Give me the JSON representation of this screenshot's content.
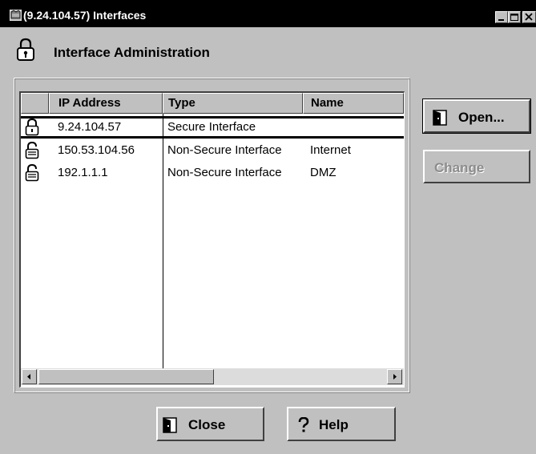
{
  "window": {
    "title": "(9.24.104.57) Interfaces",
    "controls": [
      "minimize-icon",
      "maximize-icon",
      "close-icon"
    ]
  },
  "header": {
    "title": "Interface Administration",
    "icon": "padlock-icon"
  },
  "table": {
    "columns": [
      "",
      "IP Address",
      "Type",
      "Name"
    ],
    "rows": [
      {
        "icon": "locked-padlock-icon",
        "ip": "9.24.104.57",
        "type": "Secure Interface",
        "name": "",
        "selected": true
      },
      {
        "icon": "unlocked-padlock-icon",
        "ip": "150.53.104.56",
        "type": "Non-Secure Interface",
        "name": "Internet",
        "selected": false
      },
      {
        "icon": "unlocked-padlock-icon",
        "ip": "192.1.1.1",
        "type": "Non-Secure Interface",
        "name": "DMZ",
        "selected": false
      }
    ]
  },
  "buttons": {
    "open": "Open...",
    "change": "Change",
    "close": "Close",
    "help": "Help"
  },
  "colors": {
    "titlebar": "#000000",
    "face": "#c0c0c0",
    "table_bg": "#ffffff",
    "disabled_text": "#8c8c8c"
  }
}
